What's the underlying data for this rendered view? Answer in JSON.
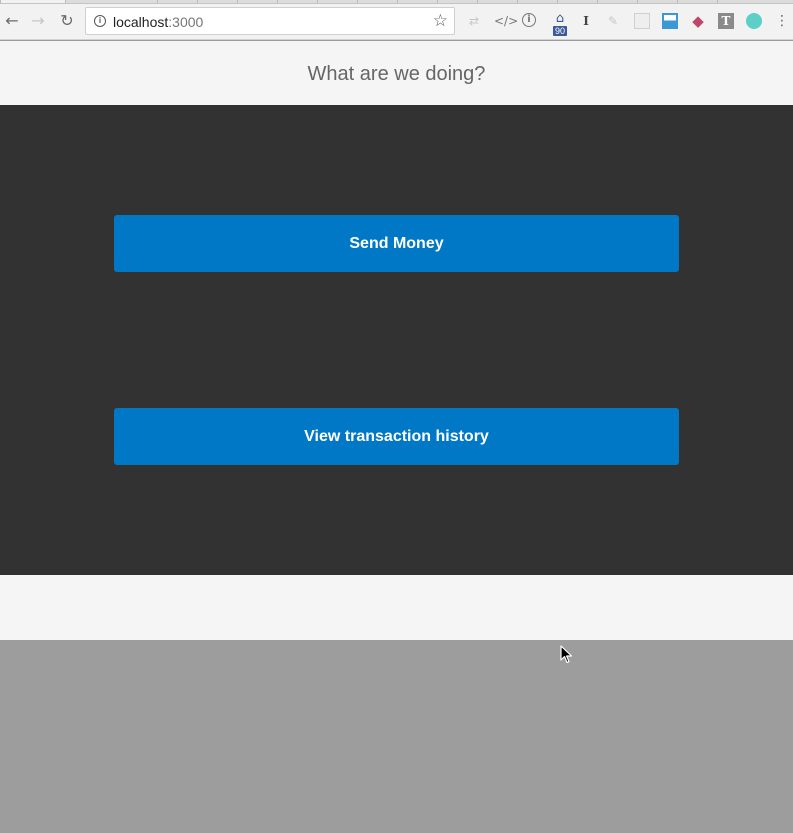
{
  "browser": {
    "url_host": "localhost",
    "url_port": ":3000",
    "extension_badge": "90",
    "extension_t_label": "T",
    "extension_i_label": "I"
  },
  "page": {
    "title": "What are we doing?"
  },
  "actions": {
    "send_money_label": "Send Money",
    "history_label": "View transaction history"
  },
  "colors": {
    "primary_button": "#0078c5",
    "panel_background": "#323232",
    "header_background": "#f5f5f5"
  }
}
